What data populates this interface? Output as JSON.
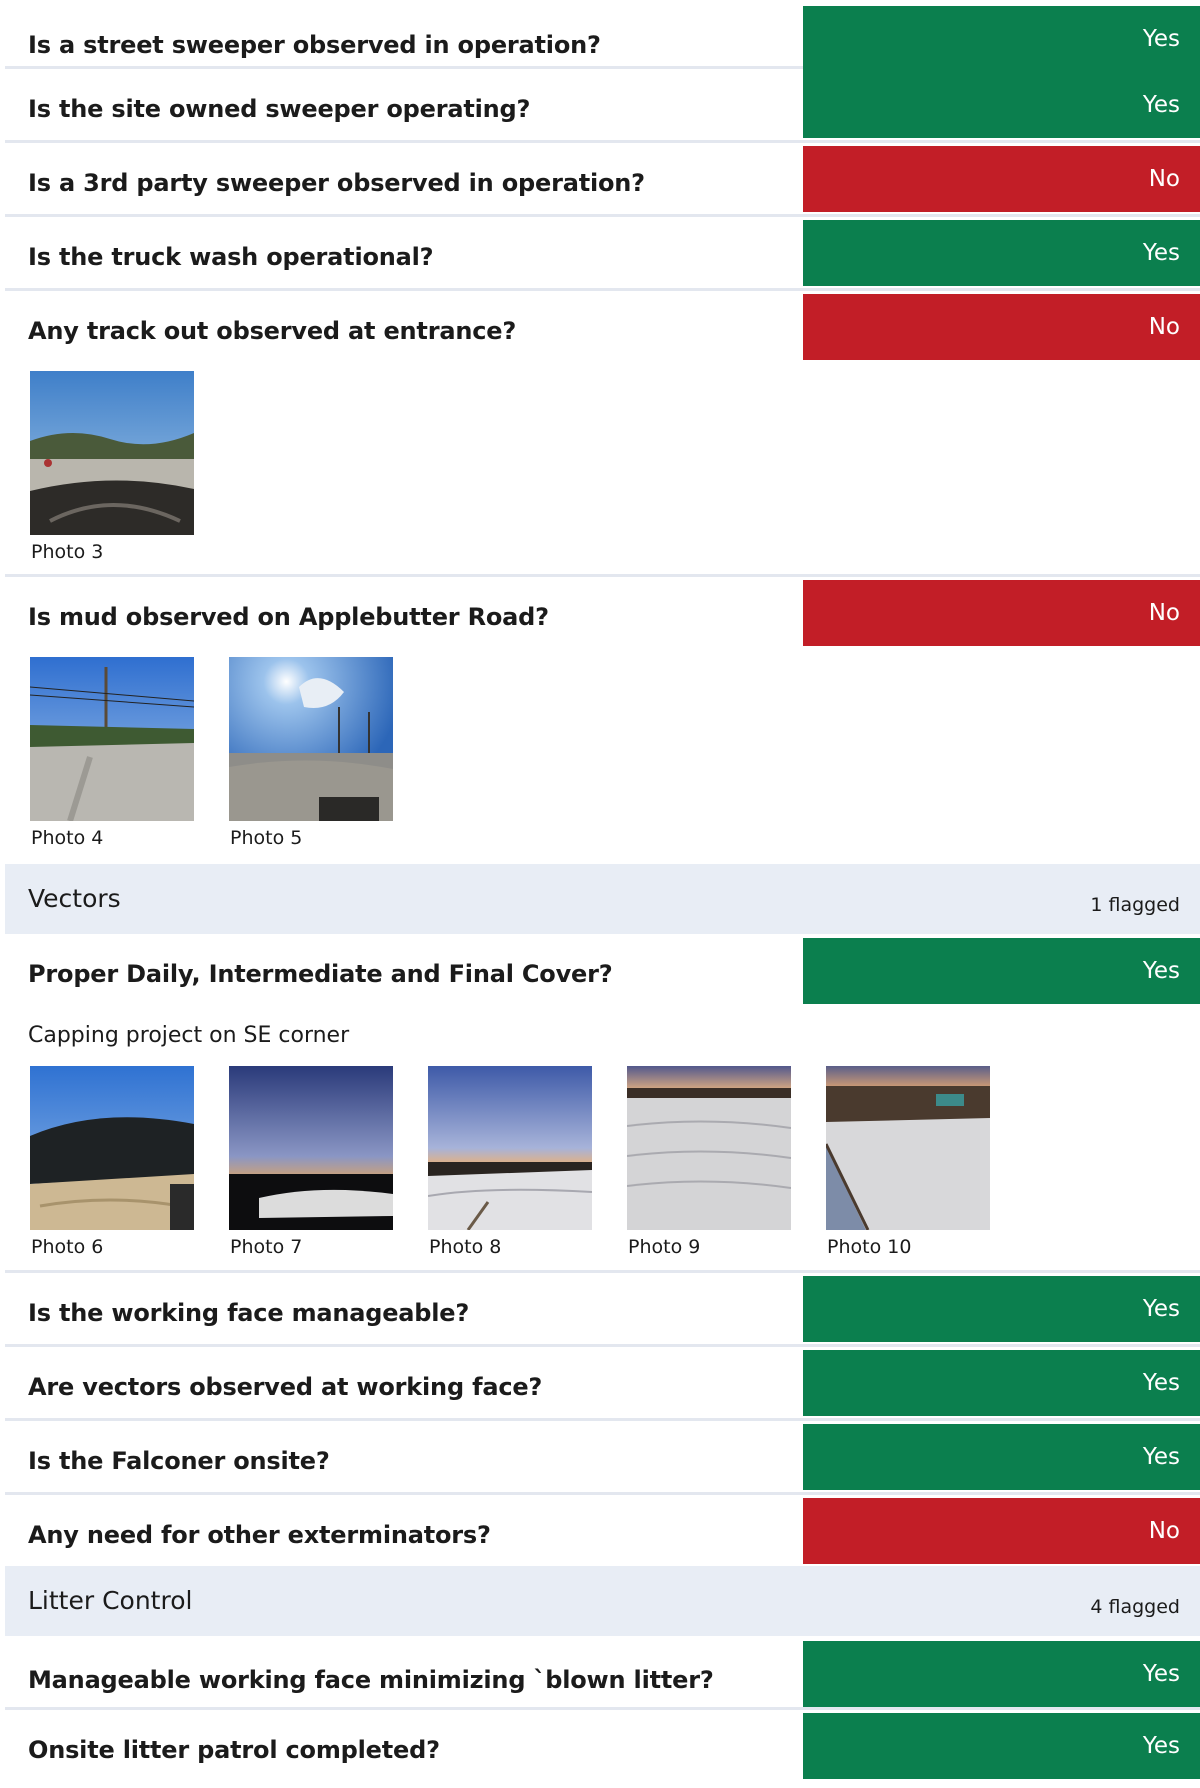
{
  "items": [
    {
      "question": "Is a street sweeper observed in operation?",
      "answer": "Yes"
    },
    {
      "question": "Is the site owned sweeper operating?",
      "answer": "Yes"
    },
    {
      "question": "Is a 3rd party sweeper observed in operation?",
      "answer": "No"
    },
    {
      "question": "Is the truck wash operational?",
      "answer": "Yes"
    },
    {
      "question": "Any track out observed at entrance?",
      "answer": "No",
      "photos": [
        "Photo 3"
      ]
    },
    {
      "question": "Is mud observed on Applebutter Road?",
      "answer": "No",
      "photos": [
        "Photo 4",
        "Photo 5"
      ]
    }
  ],
  "sections": [
    {
      "title": "Vectors",
      "flagged": "1 flagged",
      "items": [
        {
          "question": "Proper Daily, Intermediate and Final Cover?",
          "answer": "Yes",
          "note": "Capping project on SE corner",
          "photos": [
            "Photo 6",
            "Photo 7",
            "Photo 8",
            "Photo 9",
            "Photo 10"
          ]
        },
        {
          "question": "Is the working face manageable?",
          "answer": "Yes"
        },
        {
          "question": "Are vectors observed at working face?",
          "answer": "Yes"
        },
        {
          "question": "Is the Falconer onsite?",
          "answer": "Yes"
        },
        {
          "question": "Any need for other exterminators?",
          "answer": "No"
        }
      ]
    },
    {
      "title": "Litter Control",
      "flagged": "4 flagged",
      "items": [
        {
          "question": "Manageable working face minimizing `blown litter?",
          "answer": "Yes"
        },
        {
          "question": "Onsite litter patrol completed?",
          "answer": "Yes"
        }
      ]
    }
  ],
  "colors": {
    "yes": "#0b7f4e",
    "no": "#c21e27",
    "section_bg": "#e8edf5",
    "divider": "#e3e7ef"
  },
  "photo_scenes": {
    "Photo 3": "windshield-road",
    "Photo 4": "road-power-lines",
    "Photo 5": "windshield-sun",
    "Photo 6": "black-cover-slope",
    "Photo 7": "dusk-white-cover",
    "Photo 8": "dusk-white-slope",
    "Photo 9": "white-cover-closeup",
    "Photo 10": "white-cover-liner"
  }
}
